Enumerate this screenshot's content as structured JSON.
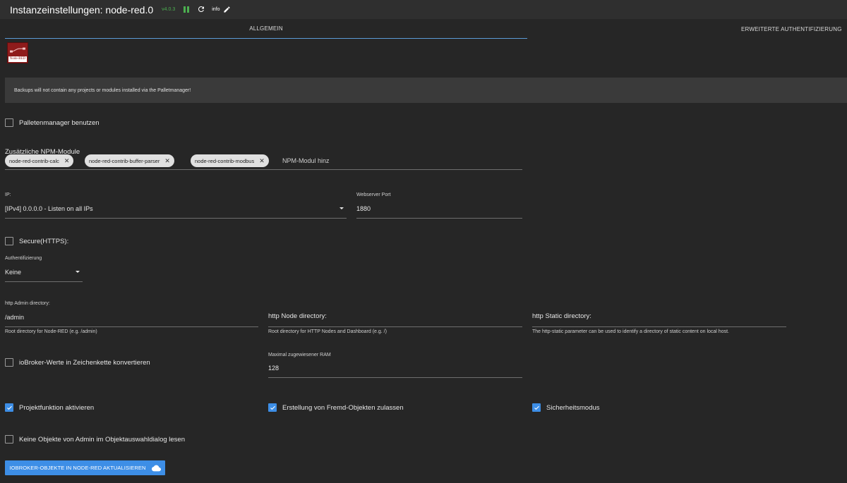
{
  "header": {
    "title": "Instanzeinstellungen: node-red.0",
    "version": "v4.0.3",
    "info": "info"
  },
  "tabs": [
    {
      "label": "ALLGEMEIN",
      "active": true
    },
    {
      "label": "ERWEITERTE AUTHENTIFIZIERUNG",
      "active": false
    }
  ],
  "logo_text": "Node-RED",
  "notice": "Backups will not contain any projects or modules installed via the Palletmanager!",
  "palette_manager": {
    "label": "Palletenmanager benutzen",
    "checked": false
  },
  "npm_modules": {
    "label": "Zusätzliche NPM-Module",
    "chips": [
      "node-red-contrib-calc",
      "node-red-contrib-buffer-parser",
      "node-red-contrib-modbus"
    ],
    "placeholder": "NPM-Modul hinz"
  },
  "ip": {
    "label": "IP:",
    "value": "[IPv4] 0.0.0.0 - Listen on all IPs"
  },
  "webserver_port": {
    "label": "Webserver Port",
    "value": "1880"
  },
  "secure": {
    "label": "Secure(HTTPS):",
    "checked": false
  },
  "authentication": {
    "label": "Authentifizierung",
    "value": "Keine"
  },
  "admin_dir": {
    "label": "http Admin directory:",
    "value": "/admin",
    "helper": "Root directory for Node-RED (e.g. /admin)"
  },
  "node_dir": {
    "label": "http Node directory:",
    "value": "",
    "helper": "Root directory for HTTP Nodes and Dashboard (e.g. /)"
  },
  "static_dir": {
    "label": "http Static directory:",
    "value": "",
    "helper": "The http-static parameter can be used to identify a directory of static content on local host."
  },
  "convert_values": {
    "label": "ioBroker-Werte in Zeichenkette konvertieren",
    "checked": false
  },
  "max_ram": {
    "label": "Maximal zugewiesener RAM",
    "value": "128"
  },
  "project_mode": {
    "label": "Projektfunktion aktivieren",
    "checked": true
  },
  "foreign_objects": {
    "label": "Erstellung von Fremd-Objekten zulassen",
    "checked": true
  },
  "safe_mode": {
    "label": "Sicherheitsmodus",
    "checked": true
  },
  "no_admin_objects": {
    "label": "Keine Objekte von Admin im Objektauswahldialog lesen",
    "checked": false
  },
  "update_button": {
    "label": "IOBROKER-OBJEKTE IN NODE-RED AKTUALISIEREN",
    "icon": "cloud-upload-icon"
  },
  "colors": {
    "accent": "#3d8ee6",
    "running": "#4caf50",
    "background": "#262626"
  }
}
